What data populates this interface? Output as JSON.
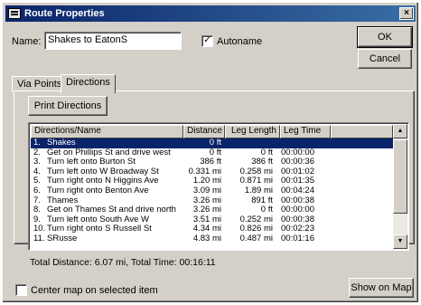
{
  "window": {
    "title": "Route Properties",
    "close_glyph": "×",
    "icon": "route-icon"
  },
  "name_field": {
    "label": "Name:",
    "value": "Shakes to EatonS"
  },
  "autoname": {
    "label": "Autoname",
    "checked": true,
    "check_glyph": "✓"
  },
  "buttons": {
    "ok": "OK",
    "cancel": "Cancel",
    "print": "Print Directions",
    "show_on_map": "Show on Map"
  },
  "tabs": [
    {
      "label": "Via Points",
      "active": false
    },
    {
      "label": "Directions",
      "active": true
    }
  ],
  "directions": {
    "columns": [
      "Directions/Name",
      "Distance",
      "Leg Length",
      "Leg Time"
    ],
    "rows": [
      {
        "num": "1.",
        "name": "Shakes",
        "distance": "0 ft",
        "leg": "",
        "time": "",
        "selected": true
      },
      {
        "num": "2.",
        "name": "Get on Phillips St and drive west",
        "distance": "0 ft",
        "leg": "0 ft",
        "time": "00:00:00"
      },
      {
        "num": "3.",
        "name": "Turn left onto Burton St",
        "distance": "386 ft",
        "leg": "386 ft",
        "time": "00:00:36"
      },
      {
        "num": "4.",
        "name": "Turn left onto W Broadway St",
        "distance": "0.331 mi",
        "leg": "0.258 mi",
        "time": "00:01:02"
      },
      {
        "num": "5.",
        "name": "Turn right onto N Higgins Ave",
        "distance": "1.20 mi",
        "leg": "0.871 mi",
        "time": "00:01:35"
      },
      {
        "num": "6.",
        "name": "Turn right onto Benton Ave",
        "distance": "3.09 mi",
        "leg": "1.89 mi",
        "time": "00:04:24"
      },
      {
        "num": "7.",
        "name": "Thames",
        "distance": "3.26 mi",
        "leg": "891 ft",
        "time": "00:00:38"
      },
      {
        "num": "8.",
        "name": "Get on Thames St and drive north",
        "distance": "3.26 mi",
        "leg": "0 ft",
        "time": "00:00:00"
      },
      {
        "num": "9.",
        "name": "Turn left onto South Ave W",
        "distance": "3.51 mi",
        "leg": "0.252 mi",
        "time": "00:00:38"
      },
      {
        "num": "10.",
        "name": "Turn right onto S Russell St",
        "distance": "4.34 mi",
        "leg": "0.826 mi",
        "time": "00:02:23"
      },
      {
        "num": "11.",
        "name": "SRusse",
        "distance": "4.83 mi",
        "leg": "0.487 mi",
        "time": "00:01:16"
      }
    ],
    "scroll_up_glyph": "▲",
    "scroll_down_glyph": "▼"
  },
  "totals": "Total Distance: 6.07 mi, Total Time: 00:16:11",
  "center_map": {
    "label": "Center map on selected item",
    "checked": false
  },
  "colors": {
    "face": "#d4d0c8",
    "selection": "#0a246a",
    "title_start": "#0a246a",
    "title_end": "#3a6ea5"
  }
}
